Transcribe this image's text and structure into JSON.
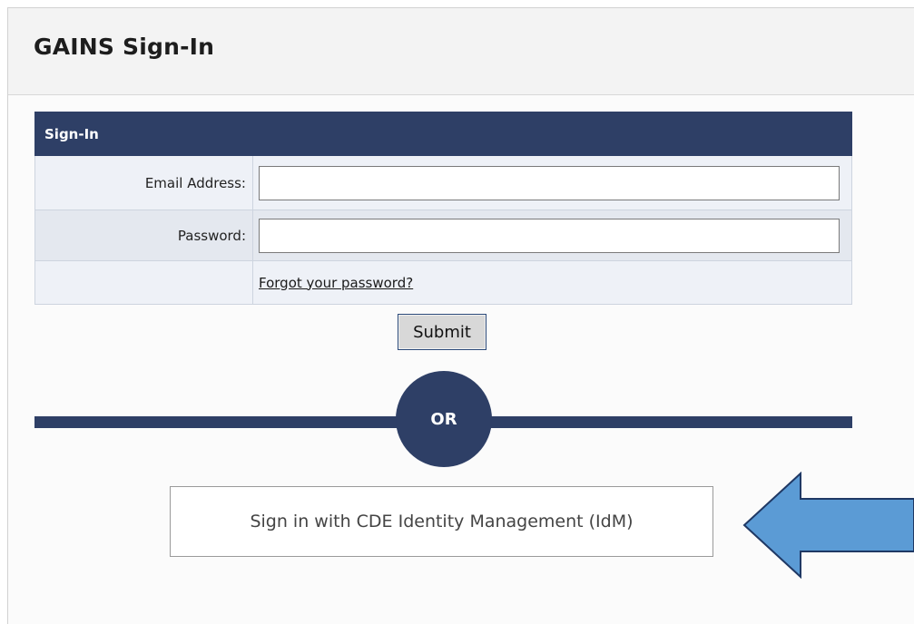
{
  "header": {
    "title": "GAINS Sign-In"
  },
  "form": {
    "heading": "Sign-In",
    "email_label": "Email Address:",
    "email_value": "",
    "password_label": "Password:",
    "password_value": "",
    "forgot_link": "Forgot your password?",
    "submit_label": "Submit"
  },
  "divider": {
    "or_label": "OR"
  },
  "idm": {
    "button_label": "Sign in with CDE Identity Management (IdM)"
  },
  "annotation": {
    "arrow_icon": "left-arrow-icon",
    "arrow_fill": "#5b9bd5",
    "arrow_stroke": "#1f3864"
  },
  "colors": {
    "brand_navy": "#2e3f66",
    "row_light": "#eef1f7",
    "row_alt": "#e4e8ef"
  }
}
